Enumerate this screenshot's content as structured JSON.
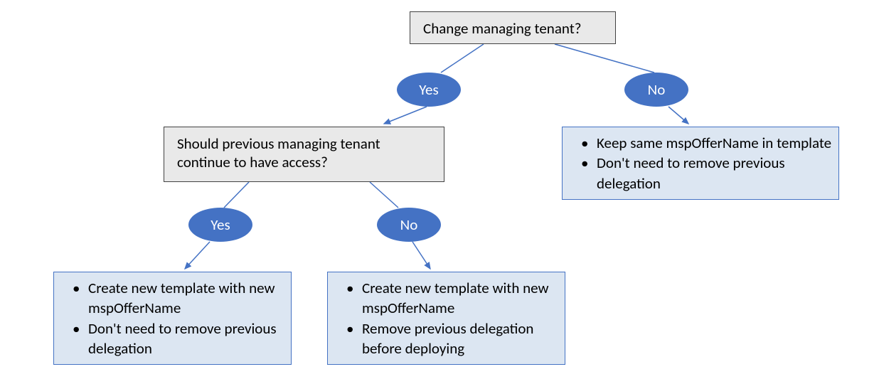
{
  "chart_data": {
    "type": "flowchart",
    "root": {
      "question": "Change managing tenant?",
      "yes": {
        "question": "Should previous managing tenant continue to have access?",
        "yes": {
          "actions": [
            "Create new template with new mspOfferName",
            "Don't need to remove previous delegation"
          ]
        },
        "no": {
          "actions": [
            "Create new template with new mspOfferName",
            "Remove previous delegation before deploying"
          ]
        }
      },
      "no": {
        "actions": [
          "Keep same mspOfferName in template",
          "Don't need to remove previous delegation"
        ]
      }
    }
  },
  "q1": "Change managing tenant?",
  "q1_yes": "Yes",
  "q1_no": "No",
  "q2": "Should previous managing tenant continue to have access?",
  "q2_yes": "Yes",
  "q2_no": "No",
  "box_right_line1": "Keep same mspOfferName in template",
  "box_right_line2": "Don't need to remove previous delegation",
  "box_left_line1": "Create new template with new mspOfferName",
  "box_left_line2": "Don't need to remove previous delegation",
  "box_mid_line1": "Create new template with new mspOfferName",
  "box_mid_line2": "Remove previous delegation before deploying"
}
